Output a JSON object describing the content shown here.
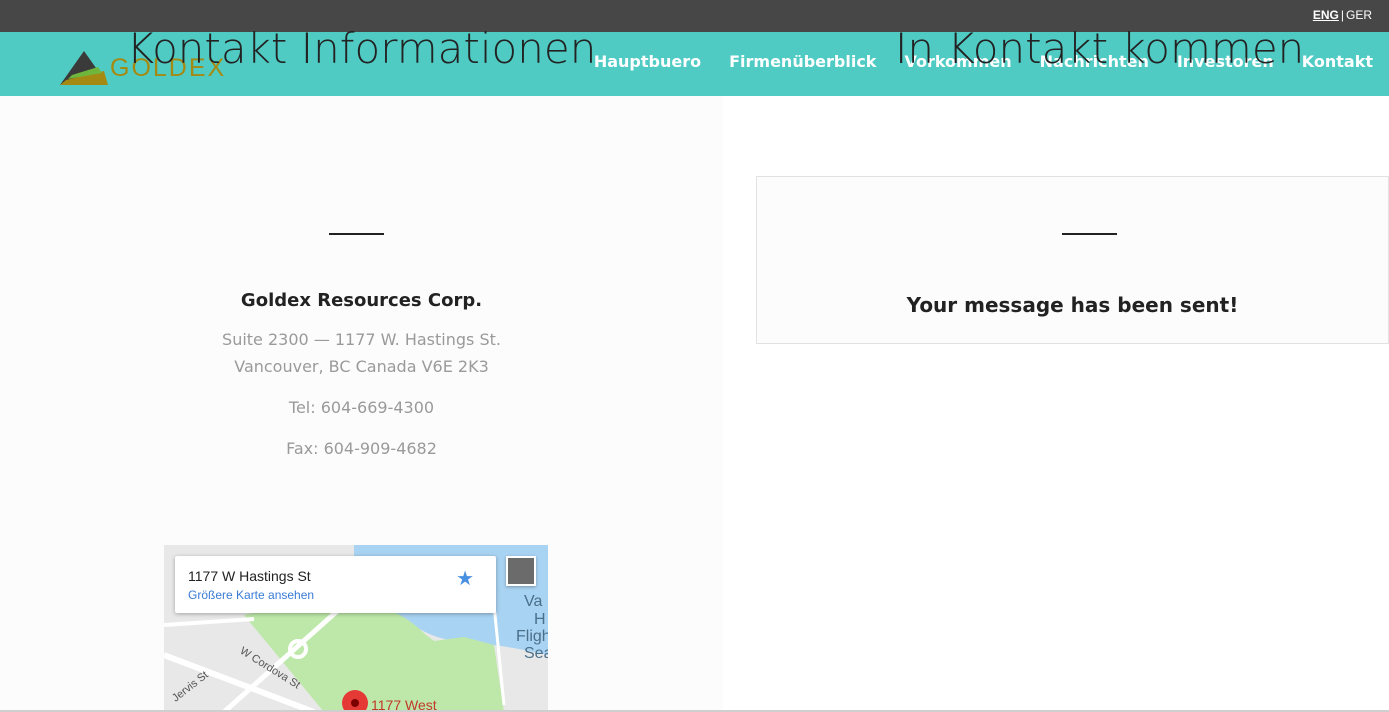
{
  "lang": {
    "eng": "ENG",
    "separator": "|",
    "ger": "GER"
  },
  "brand": {
    "name": "GOLDEX",
    "color_teal": "#50cbc4",
    "color_gold": "#a48a12",
    "color_dark": "#474747"
  },
  "nav": {
    "items": [
      "Hauptbuero",
      "Firmenüberblick",
      "Vorkommen",
      "Nachrichten",
      "Investoren",
      "Kontakt"
    ]
  },
  "contact": {
    "heading": "Kontakt Informationen",
    "company": "Goldex Resources Corp.",
    "address_line1": "Suite 2300 — 1177 W. Hastings St.",
    "address_line2": "Vancouver, BC Canada V6E 2K3",
    "tel": "Tel: 604-669-4300",
    "fax": "Fax: 604-909-4682"
  },
  "get_in_touch": {
    "heading": "In Kontakt kommen",
    "message": "Your message has been sent!"
  },
  "map": {
    "info_title": "1177 W Hastings St",
    "info_link": "Größere Karte ansehen",
    "street_cordova": "W Cordova St",
    "street_jervis": "Jervis St",
    "pin_label": "1177 West",
    "side_va": "Va",
    "side_h": "H",
    "side_fligh": "Fligh",
    "side_sea": "Sea"
  }
}
